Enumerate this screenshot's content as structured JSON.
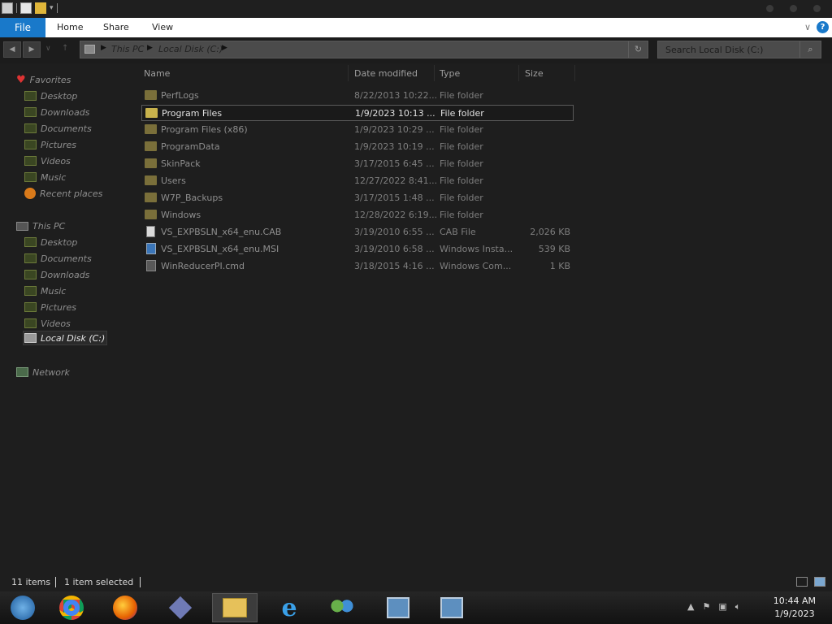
{
  "ribbon": {
    "file_label": "File",
    "tabs": [
      "Home",
      "Share",
      "View"
    ],
    "help_label": "?"
  },
  "address": {
    "segments": [
      "This PC",
      "Local Disk (C:)"
    ],
    "search_placeholder": "Search Local Disk (C:)"
  },
  "sidebar": {
    "favorites": {
      "label": "Favorites",
      "items": [
        "Desktop",
        "Downloads",
        "Documents",
        "Pictures",
        "Videos",
        "Music",
        "Recent places"
      ]
    },
    "thispc": {
      "label": "This PC",
      "items": [
        "Desktop",
        "Documents",
        "Downloads",
        "Music",
        "Pictures",
        "Videos",
        "Local Disk (C:)"
      ]
    },
    "network": {
      "label": "Network"
    }
  },
  "columns": {
    "name": "Name",
    "date": "Date modified",
    "type": "Type",
    "size": "Size"
  },
  "files": [
    {
      "name": "PerfLogs",
      "date": "8/22/2013 10:22...",
      "type": "File folder",
      "size": "",
      "icon": "folder-icon"
    },
    {
      "name": "Program Files",
      "date": "1/9/2023 10:13 ...",
      "type": "File folder",
      "size": "",
      "icon": "folder-icon"
    },
    {
      "name": "Program Files (x86)",
      "date": "1/9/2023 10:29 ...",
      "type": "File folder",
      "size": "",
      "icon": "folder-icon"
    },
    {
      "name": "ProgramData",
      "date": "1/9/2023 10:19 ...",
      "type": "File folder",
      "size": "",
      "icon": "folder-icon"
    },
    {
      "name": "SkinPack",
      "date": "3/17/2015 6:45 ...",
      "type": "File folder",
      "size": "",
      "icon": "folder-icon"
    },
    {
      "name": "Users",
      "date": "12/27/2022 8:41...",
      "type": "File folder",
      "size": "",
      "icon": "folder-icon"
    },
    {
      "name": "W7P_Backups",
      "date": "3/17/2015 1:48 ...",
      "type": "File folder",
      "size": "",
      "icon": "folder-icon"
    },
    {
      "name": "Windows",
      "date": "12/28/2022 6:19...",
      "type": "File folder",
      "size": "",
      "icon": "folder-icon"
    },
    {
      "name": "VS_EXPBSLN_x64_enu.CAB",
      "date": "3/19/2010 6:55 ...",
      "type": "CAB File",
      "size": "2,026 KB",
      "icon": "cab-file-icon"
    },
    {
      "name": "VS_EXPBSLN_x64_enu.MSI",
      "date": "3/19/2010 6:58 ...",
      "type": "Windows Insta...",
      "size": "539 KB",
      "icon": "msi-file-icon"
    },
    {
      "name": "WinReducerPI.cmd",
      "date": "3/18/2015 4:16 ...",
      "type": "Windows Com...",
      "size": "1 KB",
      "icon": "cmd-file-icon"
    }
  ],
  "selected_file": "Program Files",
  "status": {
    "item_count": "11 items",
    "selection": "1 item selected"
  },
  "taskbar": {
    "apps": [
      "start-orb-icon",
      "chrome-icon",
      "firefox-icon",
      "visual-studio-icon",
      "file-explorer-icon",
      "internet-explorer-icon",
      "users-icon",
      "network-installer-icon",
      "network-installer-icon"
    ],
    "time": "10:44 AM",
    "date": "1/9/2023"
  }
}
